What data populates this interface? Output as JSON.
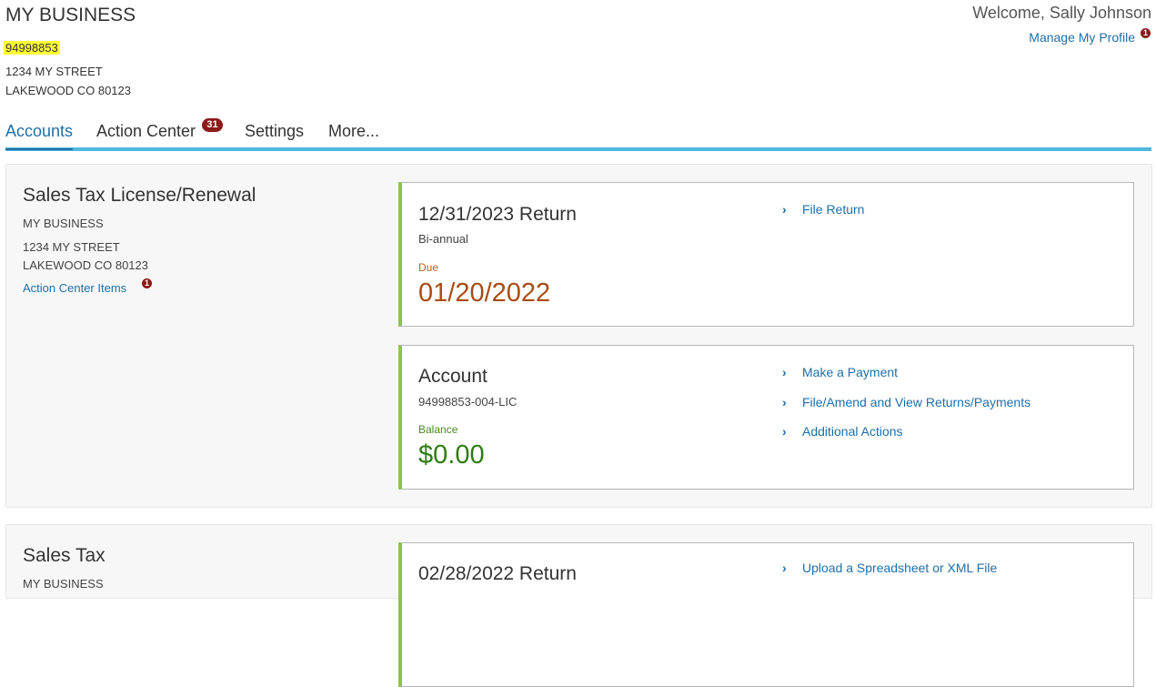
{
  "header": {
    "business_name": "MY BUSINESS",
    "business_id": "94998853",
    "address_line1": "1234 MY STREET",
    "address_line2": "LAKEWOOD CO 80123",
    "welcome": "Welcome, Sally Johnson",
    "manage_profile": "Manage My Profile",
    "profile_badge": "1"
  },
  "tabs": [
    {
      "label": "Accounts",
      "active": true
    },
    {
      "label": "Action Center",
      "badge": "31"
    },
    {
      "label": "Settings"
    },
    {
      "label": "More..."
    }
  ],
  "panels": [
    {
      "title": "Sales Tax License/Renewal",
      "business": "MY BUSINESS",
      "address_line1": "1234 MY STREET",
      "address_line2": "LAKEWOOD CO 80123",
      "action_center_link": "Action Center Items",
      "action_center_badge": "1",
      "return_card": {
        "title": "12/31/2023 Return",
        "frequency": "Bi-annual",
        "due_label": "Due",
        "due_date": "01/20/2022",
        "actions": [
          "File Return"
        ]
      },
      "account_card": {
        "title": "Account",
        "number": "94998853-004-LIC",
        "balance_label": "Balance",
        "balance": "$0.00",
        "actions": [
          "Make a Payment",
          "File/Amend and View Returns/Payments",
          "Additional Actions"
        ]
      }
    },
    {
      "title": "Sales Tax",
      "business": "MY BUSINESS",
      "return_card": {
        "title": "02/28/2022 Return",
        "actions": [
          "Upload a Spreadsheet or XML File"
        ]
      }
    }
  ],
  "colors": {
    "link": "#1f6fa8",
    "tab_underline": "#4db8e0",
    "card_accent": "#8cc63f",
    "due": "#a84d14",
    "balance": "#2f7d12",
    "badge": "#8b1a1a",
    "highlight": "#ffff33"
  },
  "icons": {
    "action_chevron": "chevron-right-icon"
  }
}
